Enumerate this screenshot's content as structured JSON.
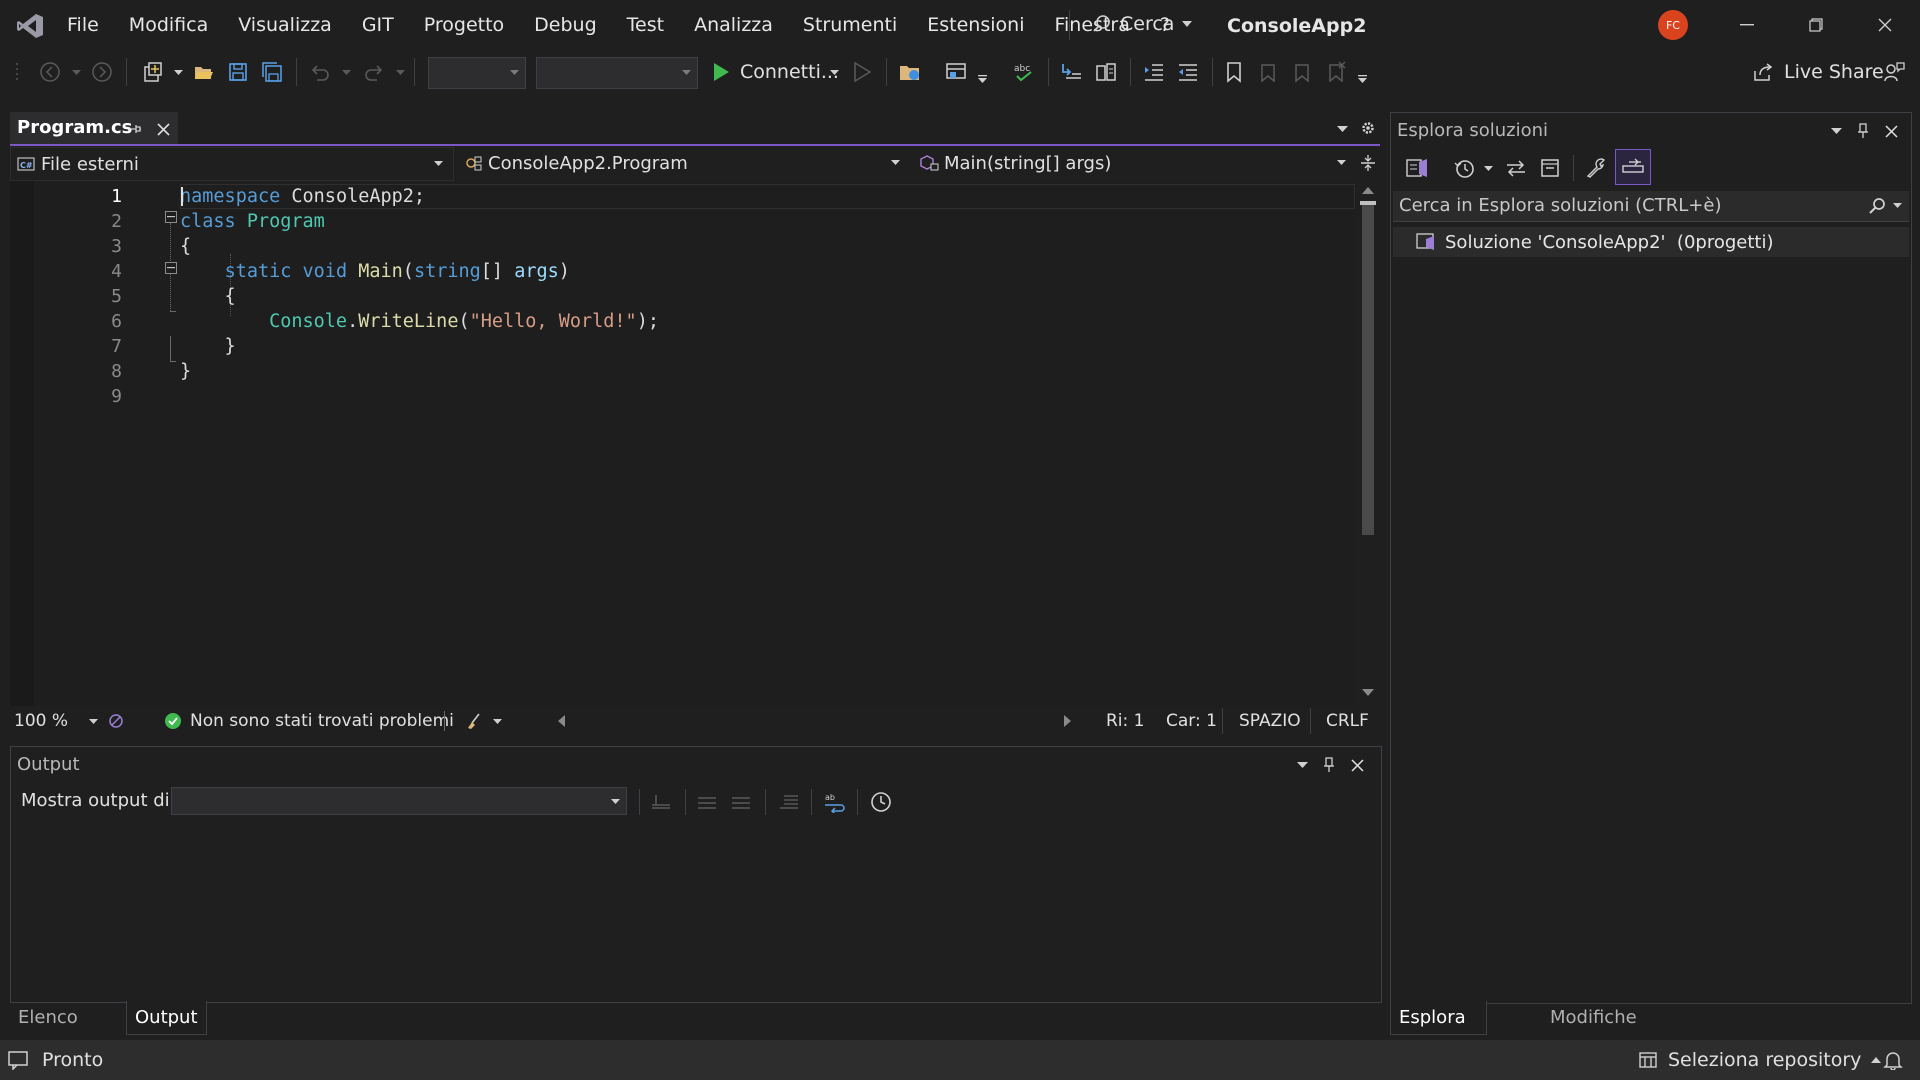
{
  "titlebar": {
    "menu": [
      "File",
      "Modifica",
      "Visualizza",
      "GIT",
      "Progetto",
      "Debug",
      "Test",
      "Analizza",
      "Strumenti",
      "Estensioni",
      "Finestra",
      "?"
    ],
    "search_label": "Cerca",
    "solution_name": "ConsoleApp2",
    "avatar_initials": "FC",
    "accent_color": "#7a58c8"
  },
  "toolbar": {
    "run_label": "Connetti...",
    "live_share_label": "Live Share"
  },
  "editor": {
    "tab_label": "Program.cs",
    "nav": {
      "project": "File esterni",
      "type": "ConsoleApp2.Program",
      "member": "Main(string[] args)"
    },
    "line_numbers": [
      "1",
      "2",
      "3",
      "4",
      "5",
      "6",
      "7",
      "8",
      "9"
    ],
    "code": {
      "l1_kw": "namespace",
      "l1_rest": " ConsoleApp2;",
      "l2_kw": "class",
      "l2_type": "Program",
      "l3": "{",
      "l4_indent": "    ",
      "l4_kw1": "static",
      "l4_kw2": "void",
      "l4_fn": "Main",
      "l4_p1": "(",
      "l4_kw3": "string",
      "l4_p2": "[] ",
      "l4_arg": "args",
      "l4_p3": ")",
      "l5": "    {",
      "l6_indent": "        ",
      "l6_obj": "Console",
      "l6_dot": ".",
      "l6_fn": "WriteLine",
      "l6_p1": "(",
      "l6_str": "\"Hello, World!\"",
      "l6_p2": ");",
      "l7": "    }",
      "l8": "}"
    },
    "status": {
      "zoom": "100 %",
      "problems": "Non sono stati trovati problemi",
      "line": "Ri: 1",
      "col": "Car: 1",
      "whitespace": "SPAZIO",
      "eol": "CRLF"
    }
  },
  "output": {
    "title": "Output",
    "show_from_label": "Mostra output di:",
    "tabs": [
      "Elenco errori",
      "Output"
    ]
  },
  "solution_explorer": {
    "title": "Esplora soluzioni",
    "search_placeholder": "Cerca in Esplora soluzioni (CTRL+è)",
    "item_label": "Soluzione 'ConsoleApp2'  (0progetti)",
    "tabs": [
      "Esplora soluzioni",
      "Modifiche GIT"
    ]
  },
  "statusbar": {
    "ready": "Pronto",
    "repo": "Seleziona repository"
  }
}
